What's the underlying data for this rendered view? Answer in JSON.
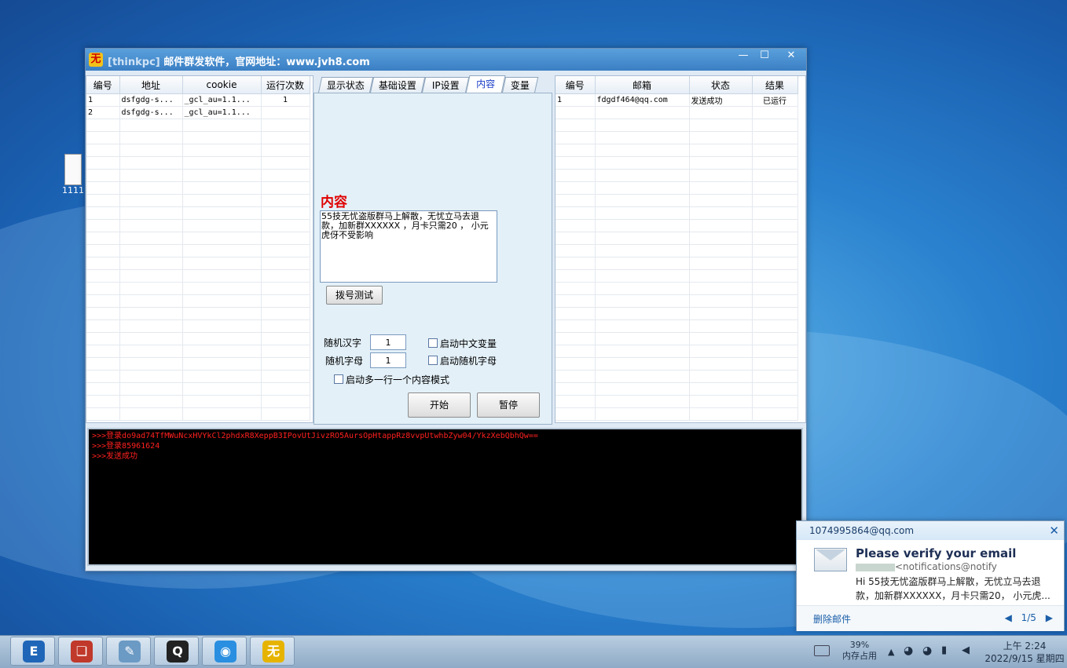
{
  "desktop": {
    "icon_label": "1111"
  },
  "window": {
    "title_blurred": "[thinkpc]",
    "title": "邮件群发软件，官网地址：www.jvh8.com",
    "controls": {
      "min": "—",
      "max": "☐",
      "close": "✕"
    }
  },
  "account_grid": {
    "headers": [
      "编号",
      "地址",
      "cookie",
      "运行次数"
    ],
    "rows": [
      [
        "1",
        "dsfgdg-s...",
        "_gcl_au=1.1...",
        "1"
      ],
      [
        "2",
        "dsfgdg-s...",
        "_gcl_au=1.1...",
        ""
      ]
    ]
  },
  "tabs": [
    "显示状态",
    "基础设置",
    "IP设置",
    "内容",
    "变量"
  ],
  "active_tab": "内容",
  "content_panel": {
    "label": "内容",
    "text": "55技无忧盗版群马上解散，无忧立马去退款，加新群XXXXXX ，月卡只需20 ， 小元虎伢不受影响",
    "dial_test_button": "拨号测试",
    "random_hanzi_label": "随机汉字",
    "random_hanzi_value": "1",
    "random_letter_label": "随机字母",
    "random_letter_value": "1",
    "enable_cn_var": "启动中文变量",
    "enable_rand_letter": "启动随机字母",
    "multiline_mode": "启动多一行一个内容模式",
    "start_button": "开始",
    "pause_button": "暂停"
  },
  "result_grid": {
    "headers": [
      "编号",
      "邮箱",
      "状态",
      "结果"
    ],
    "rows": [
      [
        "1",
        "fdgdf464@qq.com",
        "发送成功",
        "已运行"
      ]
    ]
  },
  "console_lines": [
    ">>>登录do9ad74TfMWuNcxHVYkCl2phdxR8XeppB3IPovUtJivzRO5AursOpHtappRz8vvpUtwhbZyw04/YkzXebQbhQw==",
    ">>>登录85961624",
    ">>>发送成功"
  ],
  "notification": {
    "account": "1074995864@qq.com",
    "title": "Please verify your email",
    "from": "<notifications@notify",
    "body": "Hi 55技无忧盗版群马上解散，无忧立马去退款，加新群XXXXXX，月卡只需20， 小元虎...",
    "delete": "删除邮件",
    "pager": "1/5"
  },
  "taskbar": {
    "apps": [
      {
        "icon": "E",
        "color": "#1f66b8"
      },
      {
        "icon": "❏",
        "color": "#c0392b"
      },
      {
        "icon": "✎",
        "color": "#6b9ac4"
      },
      {
        "icon": "Q",
        "color": "#222222"
      },
      {
        "icon": "◉",
        "color": "#2a8fe0"
      },
      {
        "icon": "无",
        "color": "#e6b400"
      }
    ],
    "memory_percent": "39%",
    "memory_label": "内存占用",
    "time": "上午 2:24",
    "date": "2022/9/15 星期四"
  }
}
